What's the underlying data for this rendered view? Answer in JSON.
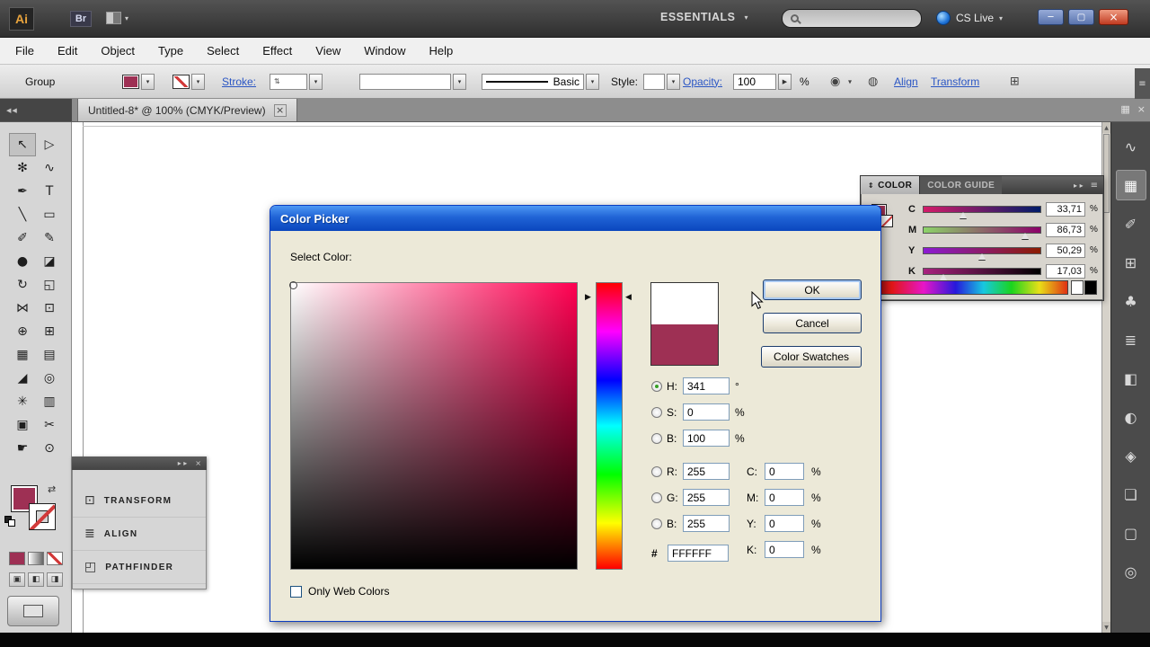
{
  "app_bar": {
    "ai_logo": "Ai",
    "bridge_label": "Br",
    "workspace": "ESSENTIALS",
    "cs_live": "CS Live"
  },
  "menu_bar": {
    "items": [
      "File",
      "Edit",
      "Object",
      "Type",
      "Select",
      "Effect",
      "View",
      "Window",
      "Help"
    ]
  },
  "control_bar": {
    "group_label": "Group",
    "stroke_label": "Stroke:",
    "brush_name": "Basic",
    "style_label": "Style:",
    "opacity_label": "Opacity:",
    "opacity_value": "100",
    "opacity_unit": "%",
    "align_label": "Align",
    "transform_label": "Transform"
  },
  "document_tab": {
    "title": "Untitled-8* @ 100% (CMYK/Preview)"
  },
  "icons": {
    "dropdown": "▾",
    "close": "×",
    "minimize": "─",
    "restore": "▢",
    "collapse_left": "◀◀",
    "collapse_right": "▸ ▸",
    "collapse_vertical": "⇕",
    "panel_menu": "≡",
    "arrange": "▦",
    "hue_arrow_left": "▶",
    "hue_arrow_right": "◀",
    "swap": "⇄",
    "spinner": "⇅",
    "slider_popup": "▶",
    "scroll_up": "▲",
    "scroll_down": "▼"
  },
  "colors": {
    "fill": "#9e3054",
    "hue_rgb": "#ff0051",
    "new_color": "#ffffff"
  },
  "toolbar": {
    "tools": [
      {
        "name": "selection-tool",
        "glyph": "↖",
        "selected": true
      },
      {
        "name": "direct-selection-tool",
        "glyph": "▷"
      },
      {
        "name": "magic-wand-tool",
        "glyph": "✻"
      },
      {
        "name": "lasso-tool",
        "glyph": "∿"
      },
      {
        "name": "pen-tool",
        "glyph": "✒"
      },
      {
        "name": "type-tool",
        "glyph": "T"
      },
      {
        "name": "line-segment-tool",
        "glyph": "╲"
      },
      {
        "name": "rectangle-tool",
        "glyph": "▭"
      },
      {
        "name": "paintbrush-tool",
        "glyph": "✐"
      },
      {
        "name": "pencil-tool",
        "glyph": "✎"
      },
      {
        "name": "blob-brush-tool",
        "glyph": "●"
      },
      {
        "name": "eraser-tool",
        "glyph": "◪"
      },
      {
        "name": "rotate-tool",
        "glyph": "↻"
      },
      {
        "name": "scale-tool",
        "glyph": "◱"
      },
      {
        "name": "width-tool",
        "glyph": "⋈"
      },
      {
        "name": "free-transform-tool",
        "glyph": "⊡"
      },
      {
        "name": "shape-builder-tool",
        "glyph": "⊕"
      },
      {
        "name": "perspective-grid-tool",
        "glyph": "⊞"
      },
      {
        "name": "mesh-tool",
        "glyph": "▦"
      },
      {
        "name": "gradient-tool",
        "glyph": "▤"
      },
      {
        "name": "eyedropper-tool",
        "glyph": "◢"
      },
      {
        "name": "blend-tool",
        "glyph": "◎"
      },
      {
        "name": "symbol-sprayer-tool",
        "glyph": "✳"
      },
      {
        "name": "column-graph-tool",
        "glyph": "▥"
      },
      {
        "name": "artboard-tool",
        "glyph": "▣"
      },
      {
        "name": "slice-tool",
        "glyph": "✂"
      },
      {
        "name": "hand-tool",
        "glyph": "☛"
      },
      {
        "name": "zoom-tool",
        "glyph": "⊙"
      }
    ]
  },
  "right_dock": {
    "icons": [
      {
        "name": "appearance-panel-icon",
        "glyph": "∿"
      },
      {
        "name": "color-panel-icon",
        "glyph": "▦",
        "active": true
      },
      {
        "name": "brushes-panel-icon",
        "glyph": "✐"
      },
      {
        "name": "swatches-panel-icon",
        "glyph": "⊞"
      },
      {
        "name": "symbols-panel-icon",
        "glyph": "♣"
      },
      {
        "name": "stroke-panel-icon",
        "glyph": "≣"
      },
      {
        "name": "gradient-panel-icon",
        "glyph": "◧"
      },
      {
        "name": "transparency-panel-icon",
        "glyph": "◐"
      },
      {
        "name": "graphic-styles-panel-icon",
        "glyph": "◈"
      },
      {
        "name": "layers-panel-icon",
        "glyph": "❏"
      },
      {
        "name": "artboards-panel-icon",
        "glyph": "▢"
      },
      {
        "name": "navigator-panel-icon",
        "glyph": "◎"
      }
    ]
  },
  "collapsed_panel": {
    "items": [
      {
        "name": "transform",
        "label": "TRANSFORM",
        "glyph": "⊡"
      },
      {
        "name": "align",
        "label": "ALIGN",
        "glyph": "≣"
      },
      {
        "name": "pathfinder",
        "label": "PATHFINDER",
        "glyph": "◰"
      }
    ]
  },
  "color_panel": {
    "tabs": [
      {
        "label": "COLOR",
        "active": true
      },
      {
        "label": "COLOR GUIDE",
        "active": false
      }
    ],
    "sliders": [
      {
        "label": "C",
        "value": "33,71",
        "unit": "%",
        "percent": 33.71,
        "track": [
          "#d41c69",
          "#001c69"
        ]
      },
      {
        "label": "M",
        "value": "86,73",
        "unit": "%",
        "percent": 86.73,
        "track": [
          "#8cd469",
          "#8c0069"
        ]
      },
      {
        "label": "Y",
        "value": "50,29",
        "unit": "%",
        "percent": 50.29,
        "track": [
          "#8c1cd4",
          "#8c1c00"
        ]
      },
      {
        "label": "K",
        "value": "17,03",
        "unit": "%",
        "percent": 17.03,
        "track": [
          "#a9227f",
          "#000000"
        ]
      }
    ]
  },
  "color_picker": {
    "title": "Color Picker",
    "select_color_label": "Select Color:",
    "buttons": {
      "ok": "OK",
      "cancel": "Cancel",
      "swatches": "Color Swatches"
    },
    "only_web_colors_label": "Only Web Colors",
    "hue_degrees": 341,
    "hsb_fields": [
      {
        "label": "H:",
        "value": "341",
        "unit": "°",
        "selected": true
      },
      {
        "label": "S:",
        "value": "0",
        "unit": "%",
        "selected": false
      },
      {
        "label": "B:",
        "value": "100",
        "unit": "%",
        "selected": false
      }
    ],
    "rgb_fields": [
      {
        "label": "R:",
        "value": "255",
        "unit": "",
        "selected": false
      },
      {
        "label": "G:",
        "value": "255",
        "unit": "",
        "selected": false
      },
      {
        "label": "B:",
        "value": "255",
        "unit": "",
        "selected": false
      }
    ],
    "cmyk_fields": [
      {
        "label": "C:",
        "value": "0",
        "unit": "%"
      },
      {
        "label": "M:",
        "value": "0",
        "unit": "%"
      },
      {
        "label": "Y:",
        "value": "0",
        "unit": "%"
      },
      {
        "label": "K:",
        "value": "0",
        "unit": "%"
      }
    ],
    "hex": {
      "label": "#",
      "value": "FFFFFF"
    }
  }
}
